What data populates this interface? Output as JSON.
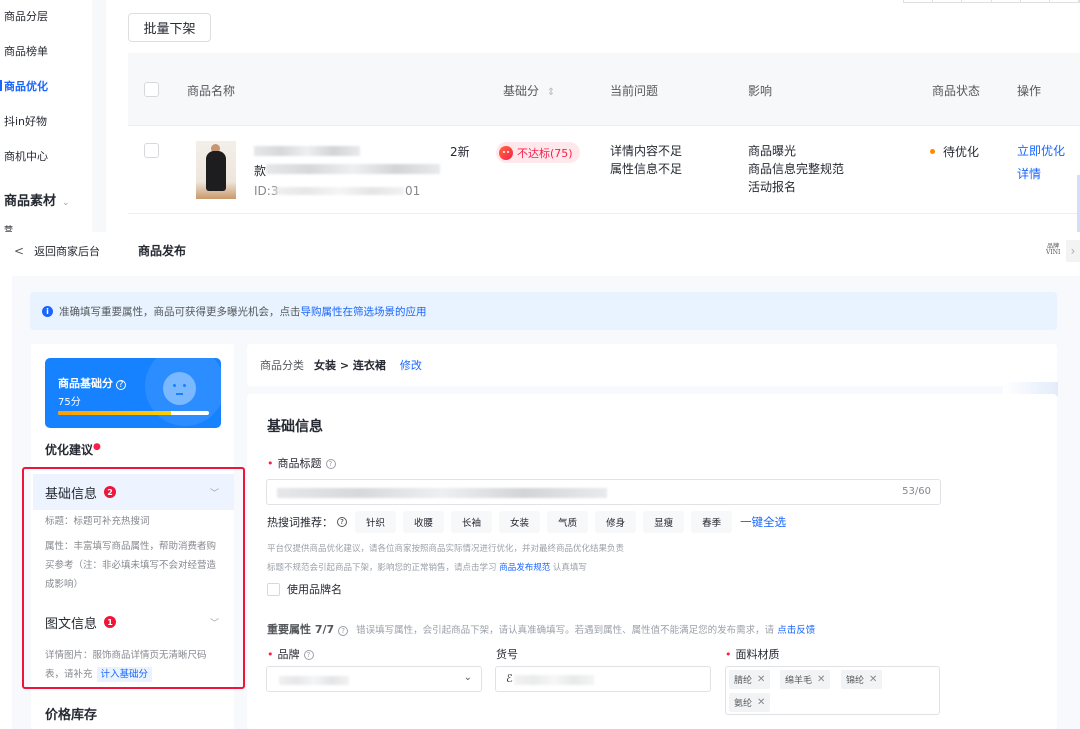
{
  "top_panel": {
    "sidebar": {
      "items": [
        {
          "label": "商品分层",
          "active": false
        },
        {
          "label": "商品榜单",
          "active": false
        },
        {
          "label": "商品优化",
          "active": true
        },
        {
          "label": "抖in好物",
          "active": false
        },
        {
          "label": "商机中心",
          "active": false
        }
      ],
      "group": {
        "label": "商品素材",
        "chevron": "chevron-down-icon"
      },
      "partial_item": "营"
    },
    "batch_button": "批量下架",
    "table": {
      "headers": [
        "商品名称",
        "基础分",
        "当前问题",
        "影响",
        "商品状态",
        "操作"
      ],
      "sort_icon": "⇕",
      "rows": [
        {
          "name_line1_end": "2新",
          "name_line2_start": "款",
          "id_prefix": "ID:3",
          "id_suffix": "01",
          "score_badge": "不达标(75)",
          "issues": [
            "详情内容不足",
            "属性信息不足"
          ],
          "impacts": [
            "商品曝光",
            "商品信息完整规范",
            "活动报名"
          ],
          "status": "待优化",
          "actions": [
            "立即优化",
            "详情"
          ]
        }
      ]
    },
    "colors": {
      "accent": "#1966ff",
      "danger": "#f5224b",
      "status_pending": "#ff8a00"
    }
  },
  "bottom_panel": {
    "header": {
      "back_label": "返回商家后台",
      "title": "商品发布",
      "brand_mark_line1": "品牌",
      "brand_mark_line2": "VINI"
    },
    "notice": {
      "text": "准确填写重要属性，商品可获得更多曝光机会，点击",
      "link": "导购属性在筛选场景的应用"
    },
    "score_card": {
      "label": "商品基础分",
      "value_text": "75分",
      "progress": 0.75
    },
    "optimization": {
      "title": "优化建议",
      "sections": [
        {
          "title": "基础信息",
          "count": "2",
          "lines": [
            "标题：标题可补充热搜词",
            "属性：丰富填写商品属性，帮助消费者购买参考（注：非必填未填写不会对经营造成影响）"
          ]
        },
        {
          "title": "图文信息",
          "count": "1",
          "lines": [
            "详情图片：服饰商品详情页无清晰尺码表，请补充"
          ],
          "tag": "计入基础分"
        }
      ],
      "next_section": "价格库存"
    },
    "category": {
      "label": "商品分类",
      "value": "女装 > 连衣裙",
      "edit_link": "修改"
    },
    "basic_info": {
      "title": "基础信息",
      "title_field": {
        "label": "商品标题",
        "counter": "53/60"
      },
      "hot_words": {
        "label": "热搜词推荐：",
        "tags": [
          "针织",
          "收腰",
          "长袖",
          "女装",
          "气质",
          "修身",
          "显瘦",
          "春季"
        ],
        "select_all": "一键全选"
      },
      "tips": [
        {
          "text": "平台仅提供商品优化建议，请各位商家按照商品实际情况进行优化，并对最终商品优化结果负责"
        },
        {
          "text": "标题不规范会引起商品下架，影响您的正常销售，请点击学习 ",
          "link": "商品发布规范",
          "suffix": " 认真填写"
        }
      ],
      "brand_name_checkbox": {
        "label": "使用品牌名",
        "checked": false
      }
    },
    "important_attrs": {
      "title": "重要属性 7/7",
      "hint": "错误填写属性，会引起商品下架，请认真准确填写。若遇到属性、属性值不能满足您的发布需求，请 ",
      "link": "点击反馈",
      "brand": {
        "label": "品牌"
      },
      "sku": {
        "label": "货号",
        "value_prefix": "ℰ"
      },
      "material": {
        "label": "面料材质",
        "chips": [
          "腈纶",
          "绵羊毛",
          "锦纶",
          "氨纶"
        ]
      }
    }
  }
}
